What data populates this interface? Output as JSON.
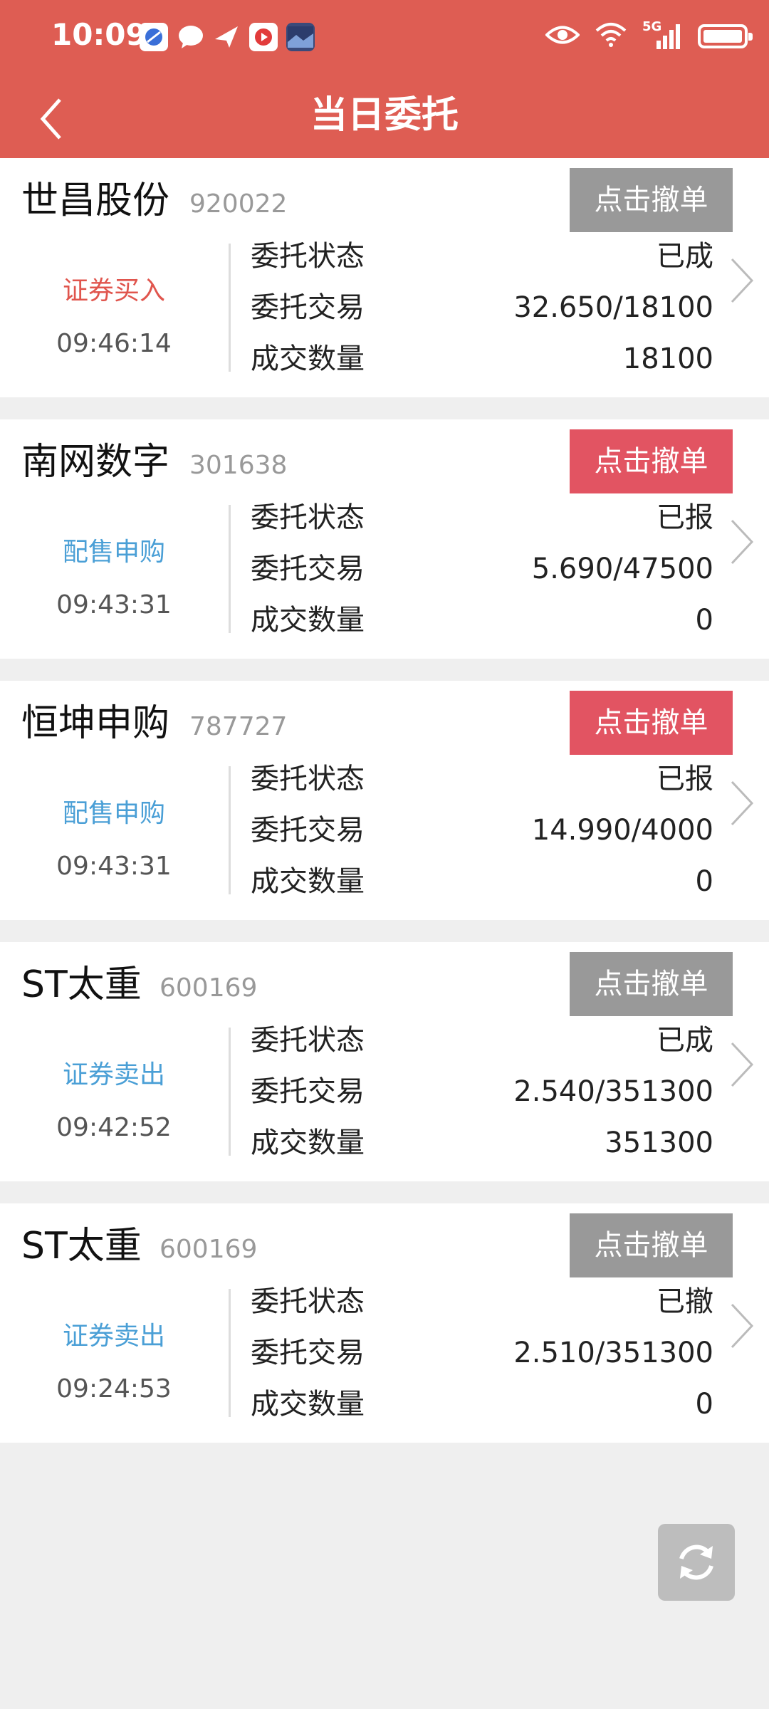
{
  "status_bar": {
    "time": "10:09",
    "network": "5G",
    "icons": [
      "browser-icon",
      "chat-icon",
      "send-icon",
      "video-icon",
      "photo-icon",
      "eye-icon",
      "wifi-icon",
      "signal-icon",
      "battery-icon"
    ]
  },
  "header": {
    "title": "当日委托",
    "back_icon": "chevron-left-icon"
  },
  "labels": {
    "status": "委托状态",
    "trade": "委托交易",
    "filled": "成交数量"
  },
  "orders": [
    {
      "name": "世昌股份",
      "code": "920022",
      "cancel_label": "点击撤单",
      "cancel_style": "gray",
      "type": "证券买入",
      "type_color": "red",
      "time": "09:46:14",
      "status": "已成",
      "trade": "32.650/18100",
      "filled": "18100"
    },
    {
      "name": "南网数字",
      "code": "301638",
      "cancel_label": "点击撤单",
      "cancel_style": "red",
      "type": "配售申购",
      "type_color": "blue",
      "time": "09:43:31",
      "status": "已报",
      "trade": "5.690/47500",
      "filled": "0"
    },
    {
      "name": "恒坤申购",
      "code": "787727",
      "cancel_label": "点击撤单",
      "cancel_style": "red",
      "type": "配售申购",
      "type_color": "blue",
      "time": "09:43:31",
      "status": "已报",
      "trade": "14.990/4000",
      "filled": "0"
    },
    {
      "name": "ST太重",
      "code": "600169",
      "cancel_label": "点击撤单",
      "cancel_style": "gray",
      "type": "证券卖出",
      "type_color": "blue",
      "time": "09:42:52",
      "status": "已成",
      "trade": "2.540/351300",
      "filled": "351300"
    },
    {
      "name": "ST太重",
      "code": "600169",
      "cancel_label": "点击撤单",
      "cancel_style": "gray",
      "type": "证券卖出",
      "type_color": "blue",
      "time": "09:24:53",
      "status": "已撤",
      "trade": "2.510/351300",
      "filled": "0"
    }
  ],
  "refresh_icon": "refresh-icon",
  "colors": {
    "header": "#de5d53",
    "cancel_gray": "#999999",
    "cancel_red": "#e25462",
    "type_red": "#e0554d",
    "type_blue": "#4a9fd6"
  }
}
